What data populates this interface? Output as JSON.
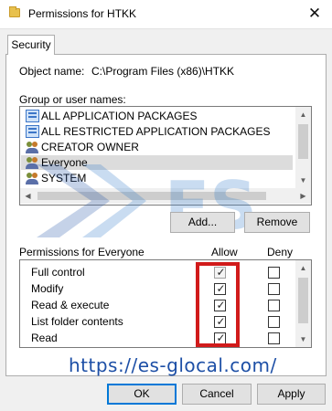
{
  "window": {
    "title": "Permissions for HTKK",
    "close_glyph": "✕",
    "folder_icon": "folder-icon"
  },
  "tabs": [
    {
      "label": "Security",
      "selected": true
    }
  ],
  "object": {
    "label": "Object name:",
    "value": "C:\\Program Files (x86)\\HTKK"
  },
  "groups": {
    "label": "Group or user names:",
    "items": [
      {
        "label": "ALL APPLICATION PACKAGES",
        "icon": "package-icon",
        "selected": false
      },
      {
        "label": "ALL RESTRICTED APPLICATION PACKAGES",
        "icon": "package-icon",
        "selected": false
      },
      {
        "label": "CREATOR OWNER",
        "icon": "users-icon",
        "selected": false
      },
      {
        "label": "Everyone",
        "icon": "users-icon",
        "selected": true
      },
      {
        "label": "SYSTEM",
        "icon": "users-icon",
        "selected": false
      }
    ]
  },
  "group_buttons": {
    "add": "Add...",
    "remove": "Remove"
  },
  "permissions": {
    "label": "Permissions for Everyone",
    "allow_header": "Allow",
    "deny_header": "Deny",
    "items": [
      {
        "label": "Full control",
        "allow": true,
        "deny": false
      },
      {
        "label": "Modify",
        "allow": true,
        "deny": false
      },
      {
        "label": "Read & execute",
        "allow": true,
        "deny": false
      },
      {
        "label": "List folder contents",
        "allow": true,
        "deny": false
      },
      {
        "label": "Read",
        "allow": true,
        "deny": false
      }
    ]
  },
  "dialog_buttons": {
    "ok": "OK",
    "cancel": "Cancel",
    "apply": "Apply"
  },
  "watermark": {
    "logo_text": "ES",
    "url": "https://es-glocal.com/"
  },
  "colors": {
    "highlight": "#d11b1b",
    "default_button_border": "#0078d7",
    "watermark_url": "#1d4fa6"
  }
}
